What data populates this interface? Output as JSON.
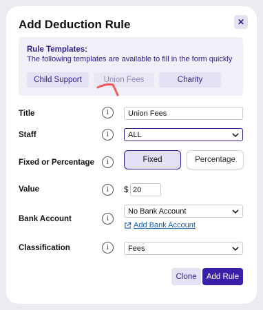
{
  "dialog": {
    "title": "Add Deduction Rule",
    "close_glyph": "✕"
  },
  "templates": {
    "heading": "Rule Templates:",
    "description": "The following templates are available to fill in the form quickly",
    "items": [
      {
        "label": "Child Support"
      },
      {
        "label": "Union Fees"
      },
      {
        "label": "Charity"
      }
    ]
  },
  "form": {
    "title": {
      "label": "Title",
      "value": "Union Fees"
    },
    "staff": {
      "label": "Staff",
      "value": "ALL"
    },
    "type": {
      "label": "Fixed or Percentage",
      "options": [
        "Fixed",
        "Percentage"
      ],
      "selected": "Fixed"
    },
    "value": {
      "label": "Value",
      "currency": "$",
      "value": "20"
    },
    "bank_account": {
      "label": "Bank Account",
      "value": "No Bank Account",
      "add_link": "Add Bank Account"
    },
    "classification": {
      "label": "Classification",
      "value": "Fees"
    },
    "info_glyph": "i"
  },
  "actions": {
    "clone_label": "Clone",
    "add_label": "Add Rule"
  },
  "colors": {
    "accent": "#3a1fa8",
    "accent_light": "#e4e1f4",
    "overlay": "#ecebf0",
    "annotation": "#f0595b"
  }
}
